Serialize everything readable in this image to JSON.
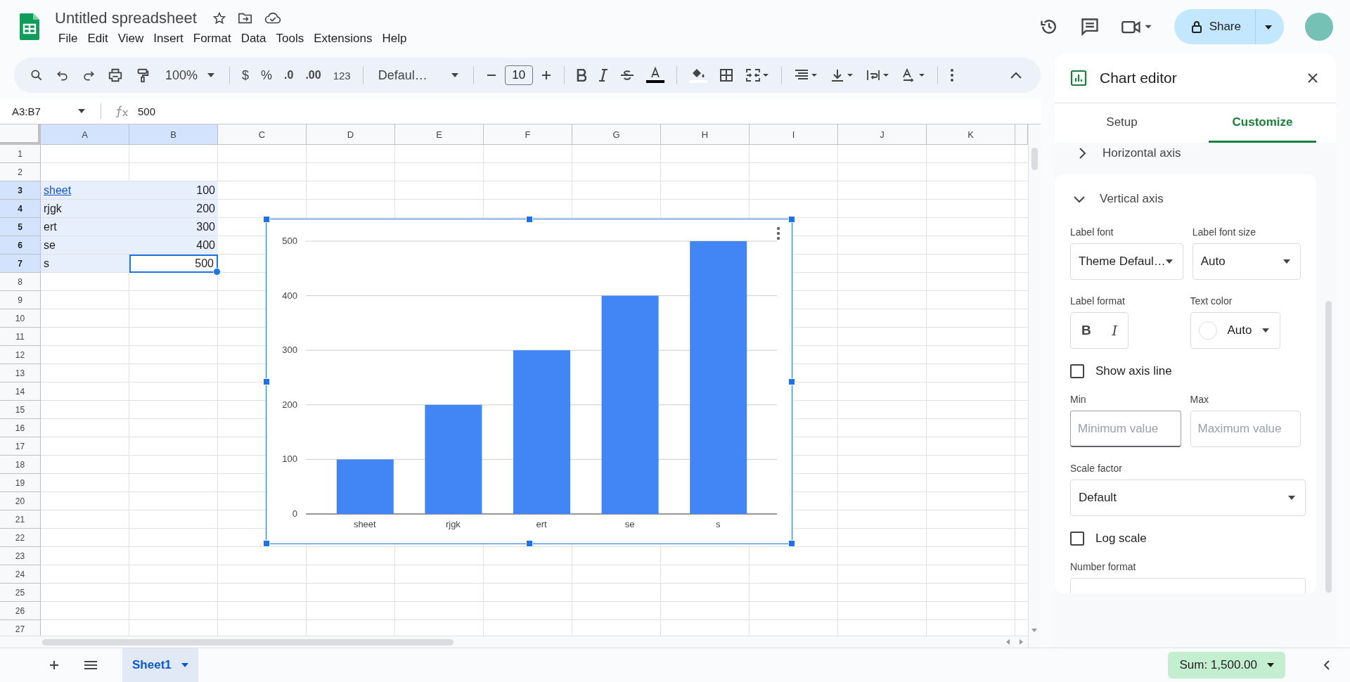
{
  "header": {
    "title": "Untitled spreadsheet",
    "menu": [
      "File",
      "Edit",
      "View",
      "Insert",
      "Format",
      "Data",
      "Tools",
      "Extensions",
      "Help"
    ],
    "share": "Share"
  },
  "toolbar": {
    "zoom": "100%",
    "currency": "$",
    "percent": "%",
    "decrease_decimal": ".0",
    "increase_decimal": ".00",
    "number_format": "123",
    "font": "Defaul…",
    "font_size": "10"
  },
  "formula_bar": {
    "name_box": "A3:B7",
    "formula": "500"
  },
  "sheet": {
    "columns": [
      {
        "label": "A",
        "selected": true
      },
      {
        "label": "B",
        "selected": true
      },
      {
        "label": "C",
        "selected": false
      },
      {
        "label": "D",
        "selected": false
      },
      {
        "label": "E",
        "selected": false
      },
      {
        "label": "F",
        "selected": false
      },
      {
        "label": "G",
        "selected": false
      },
      {
        "label": "H",
        "selected": false
      },
      {
        "label": "I",
        "selected": false
      },
      {
        "label": "J",
        "selected": false
      },
      {
        "label": "K",
        "selected": false
      }
    ],
    "rows": [
      {
        "label": "1",
        "selected": false
      },
      {
        "label": "2",
        "selected": false
      },
      {
        "label": "3",
        "selected": true,
        "cells": [
          {
            "text": "sheet",
            "kind": "link",
            "selected": true,
            "active": false
          },
          {
            "text": "100",
            "kind": "number",
            "selected": true,
            "active": false
          }
        ]
      },
      {
        "label": "4",
        "selected": true,
        "cells": [
          {
            "text": "rjgk",
            "kind": "text",
            "selected": true,
            "active": false
          },
          {
            "text": "200",
            "kind": "number",
            "selected": true,
            "active": false
          }
        ]
      },
      {
        "label": "5",
        "selected": true,
        "cells": [
          {
            "text": "ert",
            "kind": "text",
            "selected": true,
            "active": false
          },
          {
            "text": "300",
            "kind": "number",
            "selected": true,
            "active": false
          }
        ]
      },
      {
        "label": "6",
        "selected": true,
        "cells": [
          {
            "text": "se",
            "kind": "text",
            "selected": true,
            "active": false
          },
          {
            "text": "400",
            "kind": "number",
            "selected": true,
            "active": false
          }
        ]
      },
      {
        "label": "7",
        "selected": true,
        "cells": [
          {
            "text": "s",
            "kind": "text",
            "selected": true,
            "active": false
          },
          {
            "text": "500",
            "kind": "number",
            "selected": true,
            "active": true
          }
        ]
      },
      {
        "label": "8",
        "selected": false
      },
      {
        "label": "9",
        "selected": false
      },
      {
        "label": "10",
        "selected": false
      },
      {
        "label": "11",
        "selected": false
      },
      {
        "label": "12",
        "selected": false
      },
      {
        "label": "13",
        "selected": false
      },
      {
        "label": "14",
        "selected": false
      },
      {
        "label": "15",
        "selected": false
      },
      {
        "label": "16",
        "selected": false
      },
      {
        "label": "17",
        "selected": false
      },
      {
        "label": "18",
        "selected": false
      },
      {
        "label": "19",
        "selected": false
      },
      {
        "label": "20",
        "selected": false
      },
      {
        "label": "21",
        "selected": false
      },
      {
        "label": "22",
        "selected": false
      },
      {
        "label": "23",
        "selected": false
      },
      {
        "label": "24",
        "selected": false
      },
      {
        "label": "25",
        "selected": false
      },
      {
        "label": "26",
        "selected": false
      },
      {
        "label": "27",
        "selected": false
      }
    ]
  },
  "chart": {
    "chart_data": {
      "type": "bar",
      "categories": [
        "sheet",
        "rjgk",
        "ert",
        "se",
        "s"
      ],
      "series": [
        {
          "color": "#4285f4",
          "values": [
            100,
            200,
            300,
            400,
            500
          ]
        }
      ],
      "ylim": [
        0,
        500
      ],
      "yticks": [
        0,
        100,
        200,
        300,
        400,
        500
      ],
      "grid": true
    }
  },
  "chart_editor": {
    "title": "Chart editor",
    "tabs": [
      {
        "label": "Setup",
        "selected": false
      },
      {
        "label": "Customize",
        "selected": true
      }
    ],
    "sections": [
      {
        "title": "Horizontal axis",
        "expanded": false
      },
      {
        "title": "Vertical axis",
        "expanded": true
      }
    ],
    "vertical_axis": {
      "label_font": {
        "label": "Label font",
        "value": "Theme Defaul…"
      },
      "label_font_size": {
        "label": "Label font size",
        "value": "Auto"
      },
      "label_format": {
        "label": "Label format",
        "bold": "B",
        "italic": "I"
      },
      "text_color": {
        "label": "Text color",
        "value": "Auto"
      },
      "show_axis_line": {
        "label": "Show axis line",
        "checked": false
      },
      "min": {
        "label": "Min",
        "placeholder": "Minimum value"
      },
      "max": {
        "label": "Max",
        "placeholder": "Maximum value"
      },
      "scale_factor": {
        "label": "Scale factor",
        "value": "Default"
      },
      "log_scale": {
        "label": "Log scale",
        "checked": false
      },
      "number_format": {
        "label": "Number format"
      }
    }
  },
  "bottom_bar": {
    "sheets": [
      {
        "label": "Sheet1",
        "selected": true
      }
    ],
    "sum": "Sum: 1,500.00"
  }
}
